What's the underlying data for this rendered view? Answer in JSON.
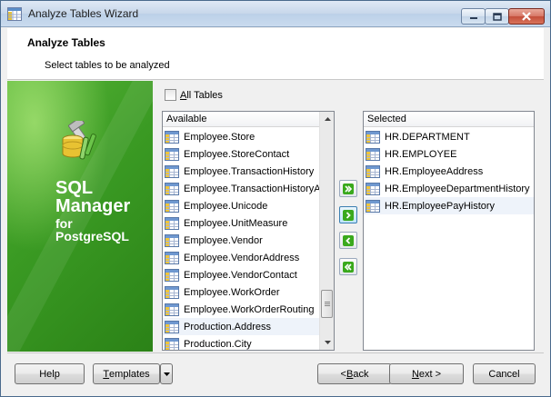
{
  "window": {
    "title": "Analyze Tables Wizard",
    "icon": "table-wizard-icon"
  },
  "header": {
    "title": "Analyze Tables",
    "subtitle": "Select tables to be analyzed"
  },
  "brand": {
    "line1": "SQL",
    "line2": "Manager",
    "line3": "for",
    "line4": "PostgreSQL",
    "background_color": "#3a9a23"
  },
  "all_tables": {
    "label_first": "A",
    "label_rest": "ll Tables",
    "checked": false
  },
  "available": {
    "header": "Available",
    "items": [
      "Employee.Store",
      "Employee.StoreContact",
      "Employee.TransactionHistory",
      "Employee.TransactionHistoryArchive",
      "Employee.Unicode",
      "Employee.UnitMeasure",
      "Employee.Vendor",
      "Employee.VendorAddress",
      "Employee.VendorContact",
      "Employee.WorkOrder",
      "Employee.WorkOrderRouting",
      "Production.Address",
      "Production.City"
    ]
  },
  "selected": {
    "header": "Selected",
    "items": [
      "HR.DEPARTMENT",
      "HR.EMPLOYEE",
      "HR.EmployeeAddress",
      "HR.EmployeeDepartmentHistory",
      "HR.EmployeePayHistory"
    ]
  },
  "move_buttons": {
    "add_all": "double-right-arrow-icon",
    "add": "right-arrow-icon",
    "remove": "left-arrow-icon",
    "remove_all": "double-left-arrow-icon"
  },
  "footer": {
    "help": "Help",
    "templates_first": "T",
    "templates_rest": "emplates",
    "back_prefix": "< ",
    "back_first": "B",
    "back_rest": "ack",
    "next_first": "N",
    "next_rest": "ext >",
    "cancel": "Cancel"
  },
  "colors": {
    "accent_green": "#2f8e1d",
    "arrow_green": "#2a9e12",
    "selection": "#eef3fa"
  }
}
